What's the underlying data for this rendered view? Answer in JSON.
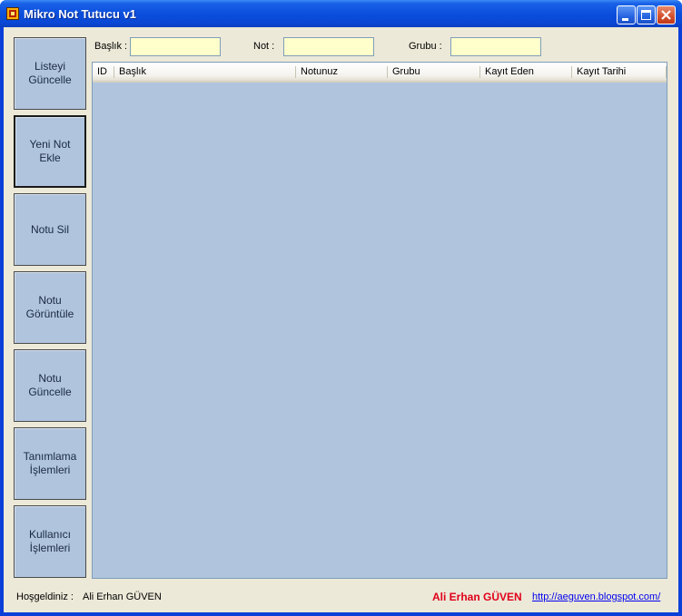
{
  "window": {
    "title": "Mikro Not Tutucu v1",
    "minimize_label": "Minimize",
    "maximize_label": "Maximize",
    "close_label": "Close"
  },
  "sidebar": {
    "buttons": [
      {
        "label": "Listeyi\nGüncelle"
      },
      {
        "label": "Yeni Not\nEkle"
      },
      {
        "label": "Notu Sil"
      },
      {
        "label": "Notu\nGörüntüle"
      },
      {
        "label": "Notu\nGüncelle"
      },
      {
        "label": "Tanımlama\nİşlemleri"
      },
      {
        "label": "Kullanıcı\nİşlemleri"
      }
    ]
  },
  "filters": {
    "baslik_label": "Başlık :",
    "baslik_value": "",
    "not_label": "Not :",
    "not_value": "",
    "grubu_label": "Grubu :",
    "grubu_value": ""
  },
  "table": {
    "columns": [
      "ID",
      "Başlık",
      "Notunuz",
      "Grubu",
      "Kayıt Eden",
      "Kayıt Tarihi"
    ],
    "rows": []
  },
  "status": {
    "welcome_label": "Hoşgeldiniz :",
    "user_name": "Ali Erhan GÜVEN",
    "author": "Ali Erhan GÜVEN",
    "link": "http://aeguven.blogspot.com/"
  },
  "colors": {
    "list_background": "#b0c4de",
    "field_background": "#ffffcc",
    "author_color": "#e0001a",
    "titlebar_blue": "#0b4fdd"
  }
}
